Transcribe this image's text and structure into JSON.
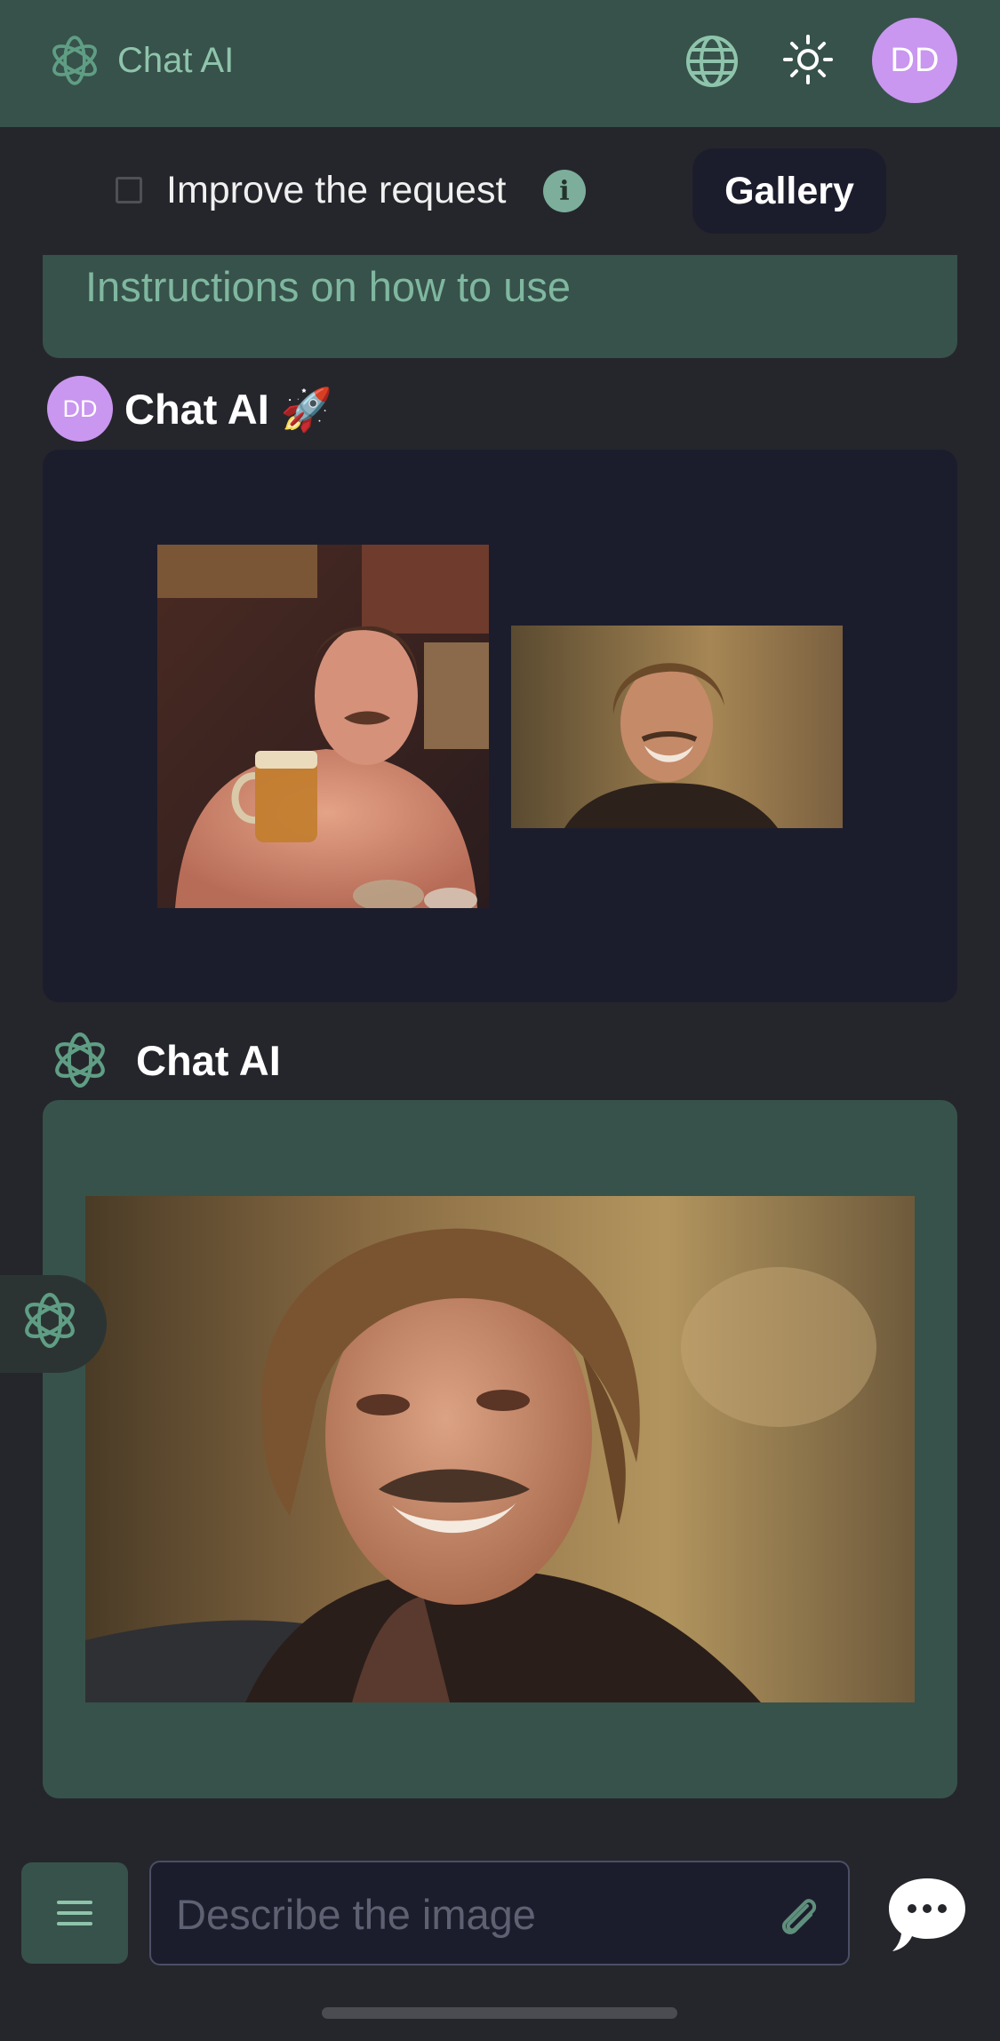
{
  "header": {
    "brand": "Chat AI",
    "avatar_initials": "DD",
    "icons": [
      "logo-icon",
      "globe-icon",
      "sun-icon"
    ]
  },
  "options": {
    "improve_label": "Improve the request",
    "improve_checked": false,
    "info_symbol": "i",
    "gallery_label": "Gallery"
  },
  "instructions": {
    "text": "Instructions on how to use"
  },
  "user_message": {
    "avatar_initials": "DD",
    "name": "Chat AI 🚀",
    "images": [
      "photo of shirtless man with beer mug",
      "photo of smiling man with long hair"
    ]
  },
  "ai_message": {
    "name": "Chat AI",
    "image": "generated face-swap result: smiling man with mustache"
  },
  "composer": {
    "placeholder": "Describe the image",
    "icons": [
      "menu-icon",
      "paperclip-icon",
      "chat-bubble-icon"
    ]
  },
  "colors": {
    "background": "#25262b",
    "accent_green": "#37524a",
    "accent_text": "#8fc4ac",
    "card_dark": "#1c1d2c",
    "avatar_purple": "#c996f0"
  }
}
